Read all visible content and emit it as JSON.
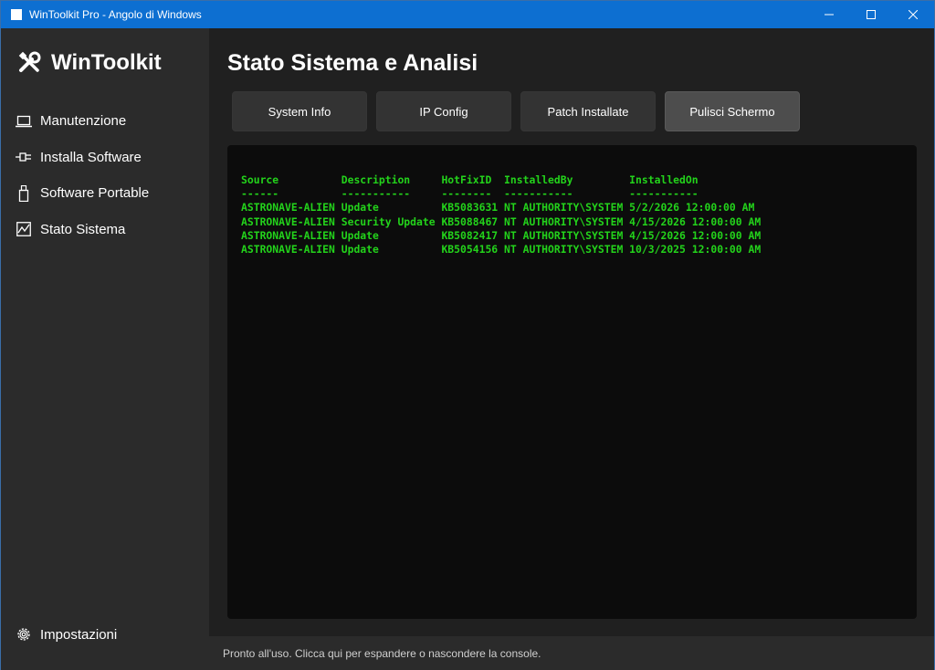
{
  "window": {
    "title": "WinToolkit Pro - Angolo di Windows",
    "minimize_glyph": "—",
    "maximize_glyph": "☐",
    "close_glyph": "✕"
  },
  "sidebar": {
    "brand": "WinToolkit",
    "brand_icon": "tools-icon",
    "items": [
      {
        "label": "Manutenzione",
        "icon": "laptop-icon"
      },
      {
        "label": "Installa Software",
        "icon": "plug-icon"
      },
      {
        "label": "Software Portable",
        "icon": "usb-drive-icon"
      },
      {
        "label": "Stato Sistema",
        "icon": "chart-icon"
      }
    ],
    "settings": {
      "label": "Impostazioni",
      "icon": "gear-icon"
    }
  },
  "main": {
    "title": "Stato Sistema e Analisi",
    "buttons": [
      {
        "label": "System Info"
      },
      {
        "label": "IP Config"
      },
      {
        "label": "Patch Installate"
      },
      {
        "label": "Pulisci Schermo",
        "state": "hover"
      }
    ],
    "console": {
      "lines": [
        "Source          Description     HotFixID  InstalledBy         InstalledOn",
        "------          -----------     --------  -----------         -----------",
        "ASTRONAVE-ALIEN Update          KB5083631 NT AUTHORITY\\SYSTEM 5/2/2026 12:00:00 AM",
        "ASTRONAVE-ALIEN Security Update KB5088467 NT AUTHORITY\\SYSTEM 4/15/2026 12:00:00 AM",
        "ASTRONAVE-ALIEN Update          KB5082417 NT AUTHORITY\\SYSTEM 4/15/2026 12:00:00 AM",
        "ASTRONAVE-ALIEN Update          KB5054156 NT AUTHORITY\\SYSTEM 10/3/2025 12:00:00 AM"
      ]
    }
  },
  "statusbar": {
    "text": "Pronto all'uso. Clicca qui per espandere o nascondere la console."
  },
  "colors": {
    "titlebar": "#0d6fd1",
    "sidebar": "#2b2b2b",
    "console_bg": "#0c0c0c",
    "console_text": "#23d31b"
  }
}
